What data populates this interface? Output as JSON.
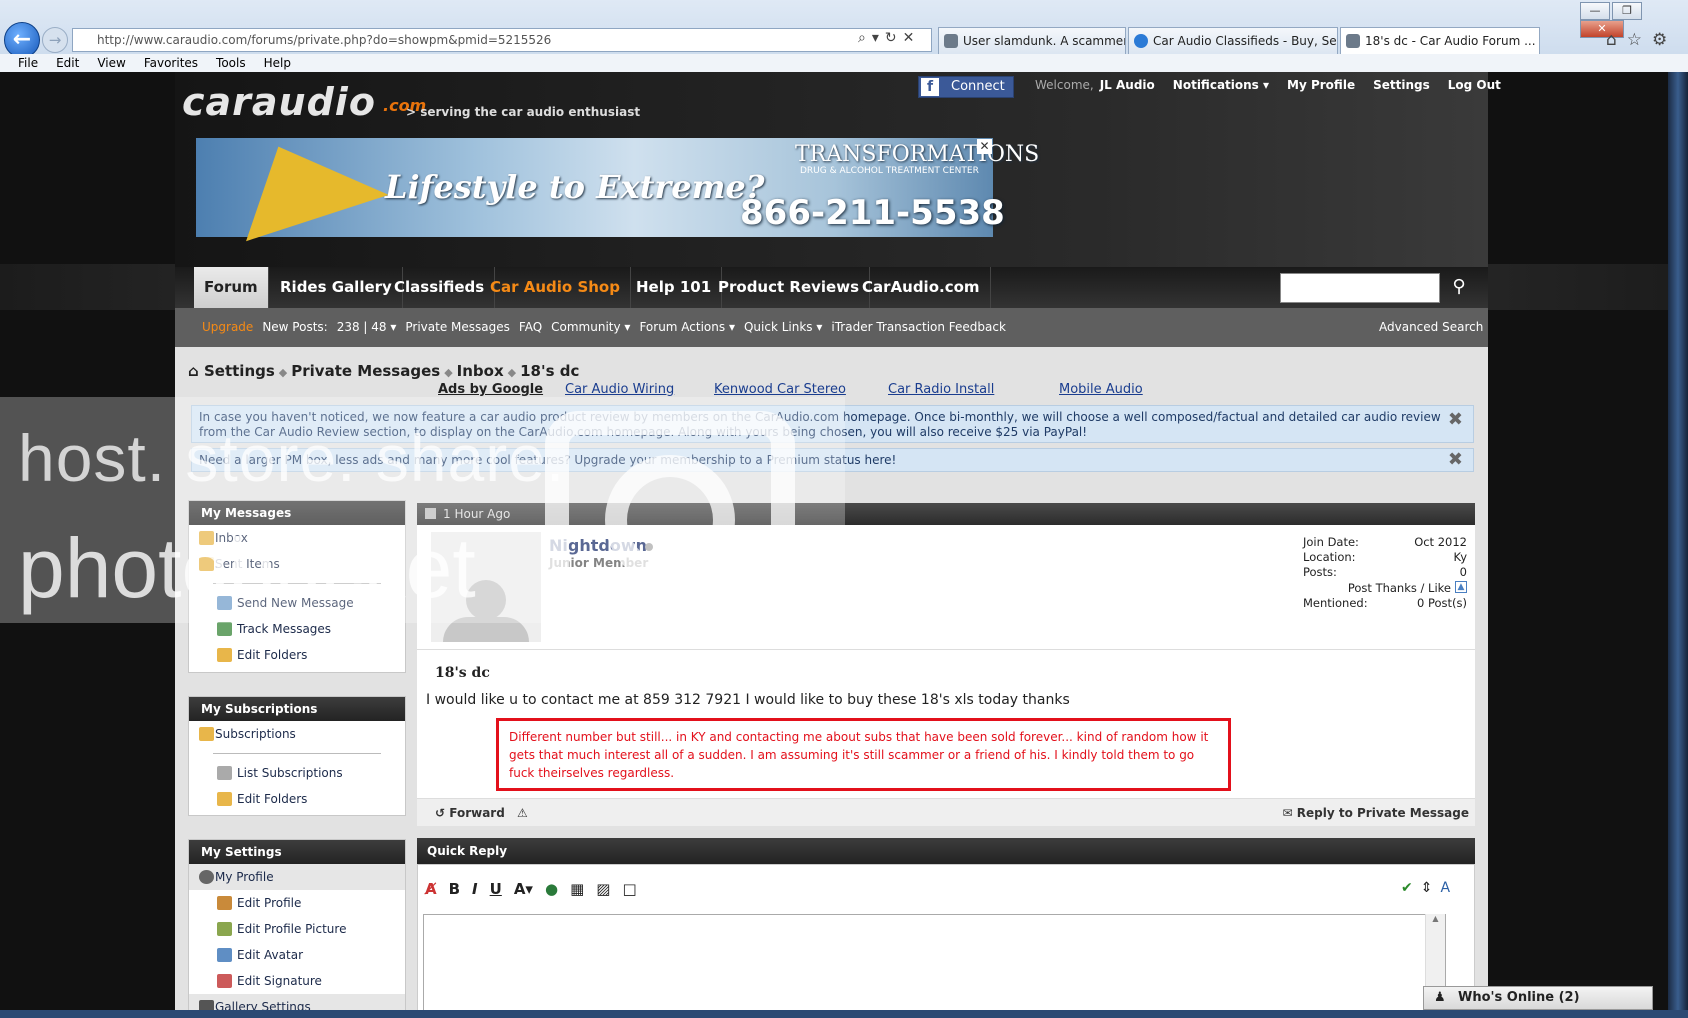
{
  "browser": {
    "url": "http://www.caraudio.com/forums/private.php?do=showpm&pmid=5215526",
    "tabs": [
      {
        "label": "User slamdunk. A scammer ha..."
      },
      {
        "label": "Car Audio Classifieds - Buy, Se..."
      },
      {
        "label": "18's dc - Car Audio Forum ..."
      }
    ],
    "menu": [
      "File",
      "Edit",
      "View",
      "Favorites",
      "Tools",
      "Help"
    ]
  },
  "header": {
    "logo": "caraudio",
    "logo_suffix": ".com",
    "tagline": "> serving the car audio enthusiast",
    "facebook": "Connect",
    "welcome": "Welcome,",
    "user": "JL Audio",
    "links": [
      "Notifications ▾",
      "My Profile",
      "Settings",
      "Log Out"
    ]
  },
  "banner": {
    "headline": "Lifestyle to Extreme?",
    "brand": "TRANSFORMATIONS",
    "brand_sub": "DRUG & ALCOHOL TREATMENT CENTER",
    "phone": "866-211-5538"
  },
  "nav": {
    "items": [
      "Forum",
      "Rides Gallery",
      "Classifieds",
      "Car Audio Shop",
      "Help 101",
      "Product Reviews",
      "CarAudio.com"
    ]
  },
  "subnav": {
    "upgrade": "Upgrade",
    "items": [
      "New Posts:",
      "238 | 48 ▾",
      "Private Messages",
      "FAQ",
      "Community ▾",
      "Forum Actions ▾",
      "Quick Links ▾",
      "iTrader Transaction Feedback"
    ],
    "advanced_search": "Advanced Search"
  },
  "breadcrumb": [
    "Settings",
    "Private Messages",
    "Inbox",
    "18's dc"
  ],
  "ads": {
    "label": "Ads by Google",
    "links": [
      "Car Audio Wiring",
      "Kenwood Car Stereo",
      "Car Radio Install",
      "Mobile Audio"
    ]
  },
  "notices": [
    "In case you haven't noticed, we now feature a car audio product review by members on the CarAudio.com homepage. Once bi-monthly, we will choose a well composed/factual and detailed car audio review from the Car Audio Review section, to display on the CarAudio.com homepage. Along with yours being chosen, you will also receive $25 via PayPal!",
    "Need a larger PM box, less ads and many more cool features? Upgrade your membership to a Premium status here!"
  ],
  "sidebar": {
    "messages": {
      "title": "My Messages",
      "folders": [
        "Inbox",
        "Sent Items"
      ],
      "actions": [
        "Send New Message",
        "Track Messages",
        "Edit Folders"
      ]
    },
    "subscriptions": {
      "title": "My Subscriptions",
      "folders": [
        "Subscriptions"
      ],
      "actions": [
        "List Subscriptions",
        "Edit Folders"
      ]
    },
    "settings": {
      "title": "My Settings",
      "folders": [
        "My Profile"
      ],
      "actions": [
        "Edit Profile",
        "Edit Profile Picture",
        "Edit Avatar",
        "Edit Signature",
        "Gallery Settings"
      ]
    }
  },
  "post": {
    "time": "1 Hour Ago",
    "username": "Nightdown",
    "user_title": "Junior Member",
    "stats": {
      "join_label": "Join Date:",
      "join": "Oct 2012",
      "location_label": "Location:",
      "location": "Ky",
      "posts_label": "Posts:",
      "posts": "0",
      "thanks": "Post Thanks / Like",
      "mentioned_label": "Mentioned:",
      "mentioned": "0 Post(s)"
    },
    "title": "18's dc",
    "body": "I would like u to contact me at 859 312 7921 I would like to buy these 18's xls today thanks",
    "annotation": "Different number but still... in KY and contacting me about subs that have been sold forever... kind of random how it gets that much interest all of a sudden. I am assuming it's still scammer or a friend of his. I kindly told them to go fuck theirselves regardless.",
    "forward": "Forward",
    "reply": "Reply to Private Message"
  },
  "quick_reply": {
    "title": "Quick Reply"
  },
  "whos_online": "Who's Online (2)",
  "watermark": {
    "line1": "host. store. share.",
    "line2": "photobucket"
  }
}
